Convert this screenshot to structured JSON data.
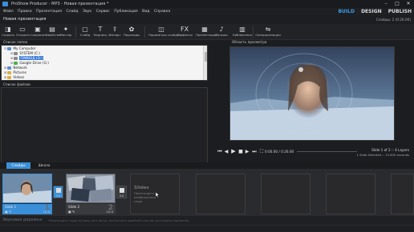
{
  "window": {
    "title": "ProShow Producer - MP3 - Новая презентация *",
    "controls": [
      "–",
      "□",
      "✕"
    ]
  },
  "menu": [
    "Файл",
    "Правка",
    "Презентация",
    "Слайд",
    "Звук",
    "Сервис",
    "Публикация",
    "Вид",
    "Справка"
  ],
  "modes": {
    "build": "BUILD",
    "design": "DESIGN",
    "publish": "PUBLISH",
    "active": "BUILD"
  },
  "project": {
    "name": "Новая презентация",
    "info": "Слайды: 2 (0:26.00)"
  },
  "toolbar": [
    {
      "label": "Создать",
      "icon": "new-icon",
      "glyph": "◨"
    },
    {
      "label": "Открыть",
      "icon": "open-icon",
      "glyph": "▭"
    },
    {
      "label": "Сохранить",
      "icon": "save-icon",
      "glyph": "▣"
    },
    {
      "label": "Свойства",
      "icon": "properties-icon",
      "glyph": "▤"
    },
    {
      "label": "Мастер",
      "icon": "wizard-icon",
      "glyph": "✦"
    },
    {
      "label": "Слайд",
      "icon": "slide-icon",
      "glyph": "▢"
    },
    {
      "label": "Надпись",
      "icon": "caption-icon",
      "glyph": "T"
    },
    {
      "label": "Импорт",
      "icon": "import-icon",
      "glyph": "⇪"
    },
    {
      "label": "Переходы",
      "icon": "transitions-icon",
      "glyph": "✿"
    },
    {
      "label": "Параметры слайда",
      "icon": "slide-options-icon",
      "glyph": "◫"
    },
    {
      "label": "Эффекты",
      "icon": "effects-icon",
      "glyph": "FX"
    },
    {
      "label": "Презентация",
      "icon": "presentation-icon",
      "glyph": "▦"
    },
    {
      "label": "Музыка",
      "icon": "music-icon",
      "glyph": "♪"
    },
    {
      "label": "Библиотека",
      "icon": "library-icon",
      "glyph": "▥"
    },
    {
      "label": "Синхронизация",
      "icon": "sync-icon",
      "glyph": "⇋"
    }
  ],
  "folders_panel": {
    "title": "Список папок",
    "items": [
      {
        "label": "My Computer",
        "indent": 0,
        "expander": "⊟",
        "color": "#5a8fd0"
      },
      {
        "label": "SYSTEM (C:)",
        "indent": 1,
        "expander": "⊞",
        "color": "#8a8a8a"
      },
      {
        "label": "ПРИВОД (D:)",
        "indent": 1,
        "expander": "⊞",
        "color": "#8a8a8a",
        "selected": true
      },
      {
        "label": "Google Drive (G:)",
        "indent": 1,
        "expander": "⊞",
        "color": "#4caf50"
      },
      {
        "label": "Network",
        "indent": 0,
        "expander": "⊞",
        "color": "#5a8fd0"
      },
      {
        "label": "Pictures",
        "indent": 0,
        "expander": "⊞",
        "color": "#d8b040"
      },
      {
        "label": "Videos",
        "indent": 0,
        "expander": "⊞",
        "color": "#d8b040"
      }
    ]
  },
  "files_panel": {
    "title": "Список файлов"
  },
  "preview": {
    "title": "Область просмотра"
  },
  "playback": {
    "time": "0:00.00 / 0:26.00",
    "slide_info": "Slide 1 of 2 :: 4 Layers",
    "slide_info2": "1 Slide Selected :: 13.000 seconds",
    "buttons": [
      {
        "name": "skip-start-icon",
        "glyph": "⏮"
      },
      {
        "name": "rewind-icon",
        "glyph": "◀"
      },
      {
        "name": "play-icon",
        "glyph": "▶"
      },
      {
        "name": "stop-icon",
        "glyph": "■"
      },
      {
        "name": "forward-icon",
        "glyph": "▶"
      },
      {
        "name": "skip-end-icon",
        "glyph": "⏭"
      },
      {
        "name": "fullscreen-icon",
        "glyph": "⛶"
      }
    ]
  },
  "tabs": [
    {
      "label": "Слайды",
      "active": true
    },
    {
      "label": "Шкала",
      "active": false
    }
  ],
  "slides": [
    {
      "name": "Slide 1",
      "number": "1",
      "duration": "10.0",
      "transition": "3.0",
      "icons": "▣ ✎"
    },
    {
      "name": "Slide 2",
      "number": "2",
      "duration": "10.0",
      "transition": "3.0",
      "icons": "▣ ✎"
    }
  ],
  "empty_slide": {
    "title": "Slides",
    "hint": "Перетащите изображения сюда"
  },
  "audio": {
    "label": "Звуковая дорожка",
    "hint": "Перетащите сюда музыку или звуки, выполните двойной щелчок для редактирования"
  },
  "colors": {
    "accent": "#3a8fd8",
    "background": "#1c1d20"
  }
}
